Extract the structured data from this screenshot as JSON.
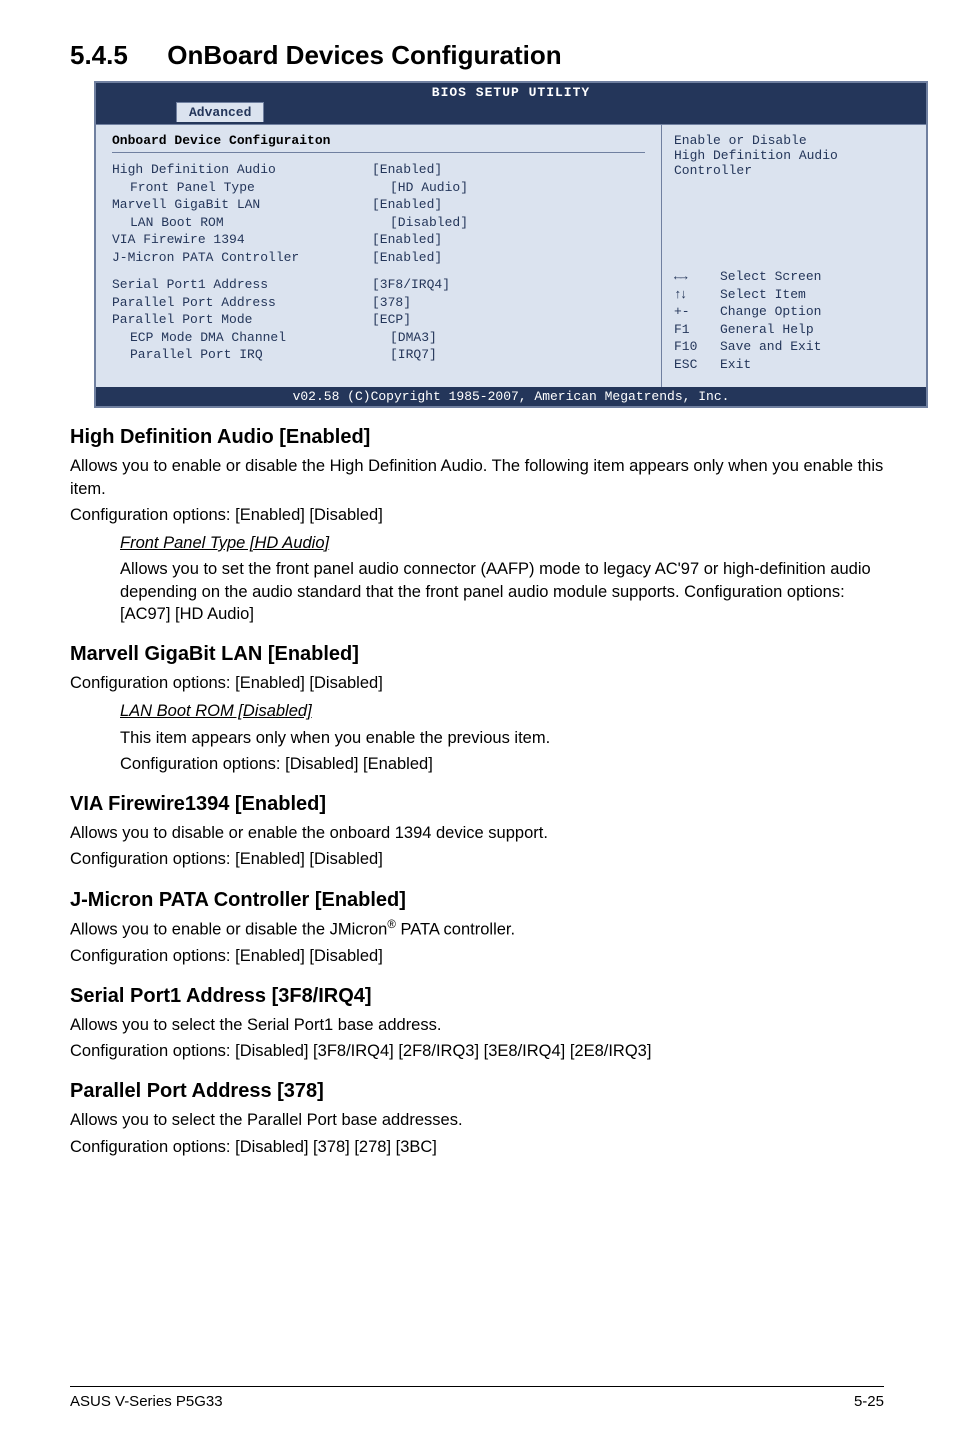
{
  "section": {
    "number": "5.4.5",
    "title": "OnBoard Devices Configuration"
  },
  "bios": {
    "title": "BIOS SETUP UTILITY",
    "tab": "Advanced",
    "panel_heading": "Onboard Device Configuraiton",
    "rows": [
      {
        "label": "High Definition Audio",
        "value": "[Enabled]",
        "indent": 0
      },
      {
        "label": "Front Panel Type",
        "value": "[HD Audio]",
        "indent": 1
      },
      {
        "label": "Marvell GigaBit LAN",
        "value": "[Enabled]",
        "indent": 0
      },
      {
        "label": "LAN Boot ROM",
        "value": "[Disabled]",
        "indent": 1
      },
      {
        "label": "VIA Firewire 1394",
        "value": "[Enabled]",
        "indent": 0
      },
      {
        "label": "J-Micron PATA Controller",
        "value": "[Enabled]",
        "indent": 0
      }
    ],
    "rows2": [
      {
        "label": "Serial Port1 Address",
        "value": "[3F8/IRQ4]",
        "indent": 0
      },
      {
        "label": "Parallel Port Address",
        "value": "[378]",
        "indent": 0
      },
      {
        "label": "Parallel Port Mode",
        "value": "[ECP]",
        "indent": 0
      },
      {
        "label": "ECP Mode DMA Channel",
        "value": "[DMA3]",
        "indent": 1
      },
      {
        "label": "Parallel Port IRQ",
        "value": "[IRQ7]",
        "indent": 1
      }
    ],
    "help_top": [
      "Enable or Disable",
      "High Definition Audio",
      "Controller"
    ],
    "help_keys": [
      {
        "key": "←→",
        "text": "Select Screen"
      },
      {
        "key": "↑↓",
        "text": "Select Item"
      },
      {
        "key": "+-",
        "text": "Change Option"
      },
      {
        "key": "F1",
        "text": "General Help"
      },
      {
        "key": "F10",
        "text": "Save and Exit"
      },
      {
        "key": "ESC",
        "text": "Exit"
      }
    ],
    "footer": "v02.58 (C)Copyright 1985-2007, American Megatrends, Inc."
  },
  "items": {
    "hda": {
      "heading": "High Definition Audio [Enabled]",
      "p1": "Allows you to enable or disable the High Definition Audio. The following item appears only when you enable this item.",
      "p2": "Configuration options: [Enabled] [Disabled]",
      "sub_h": "Front Panel Type [HD Audio]",
      "sub_p": "Allows you to set the front panel audio connector (AAFP) mode to legacy AC'97 or high-definition audio depending on the audio standard that the front panel audio module supports. Configuration options: [AC97] [HD Audio]"
    },
    "lan": {
      "heading": "Marvell GigaBit LAN [Enabled]",
      "p1": "Configuration options: [Enabled] [Disabled]",
      "sub_h": "LAN Boot ROM [Disabled]",
      "sub_p1": "This item appears only when you enable the previous item.",
      "sub_p2": "Configuration options: [Disabled] [Enabled]"
    },
    "via": {
      "heading": "VIA Firewire1394 [Enabled]",
      "p1": "Allows you to disable or enable the onboard 1394 device support.",
      "p2": "Configuration options: [Enabled] [Disabled]"
    },
    "jm": {
      "heading": "J-Micron PATA Controller [Enabled]",
      "p1a": "Allows you to enable or disable the JMicron",
      "p1b": " PATA controller.",
      "p2": "Configuration options: [Enabled] [Disabled]"
    },
    "sp": {
      "heading": "Serial Port1 Address [3F8/IRQ4]",
      "p1": "Allows you to select the Serial Port1 base address.",
      "p2": "Configuration options: [Disabled] [3F8/IRQ4] [2F8/IRQ3] [3E8/IRQ4] [2E8/IRQ3]"
    },
    "pp": {
      "heading": "Parallel Port Address [378]",
      "p1": "Allows you to select the Parallel Port base addresses.",
      "p2": "Configuration options: [Disabled] [378] [278] [3BC]"
    }
  },
  "footer": {
    "left": "ASUS V-Series P5G33",
    "right": "5-25"
  }
}
